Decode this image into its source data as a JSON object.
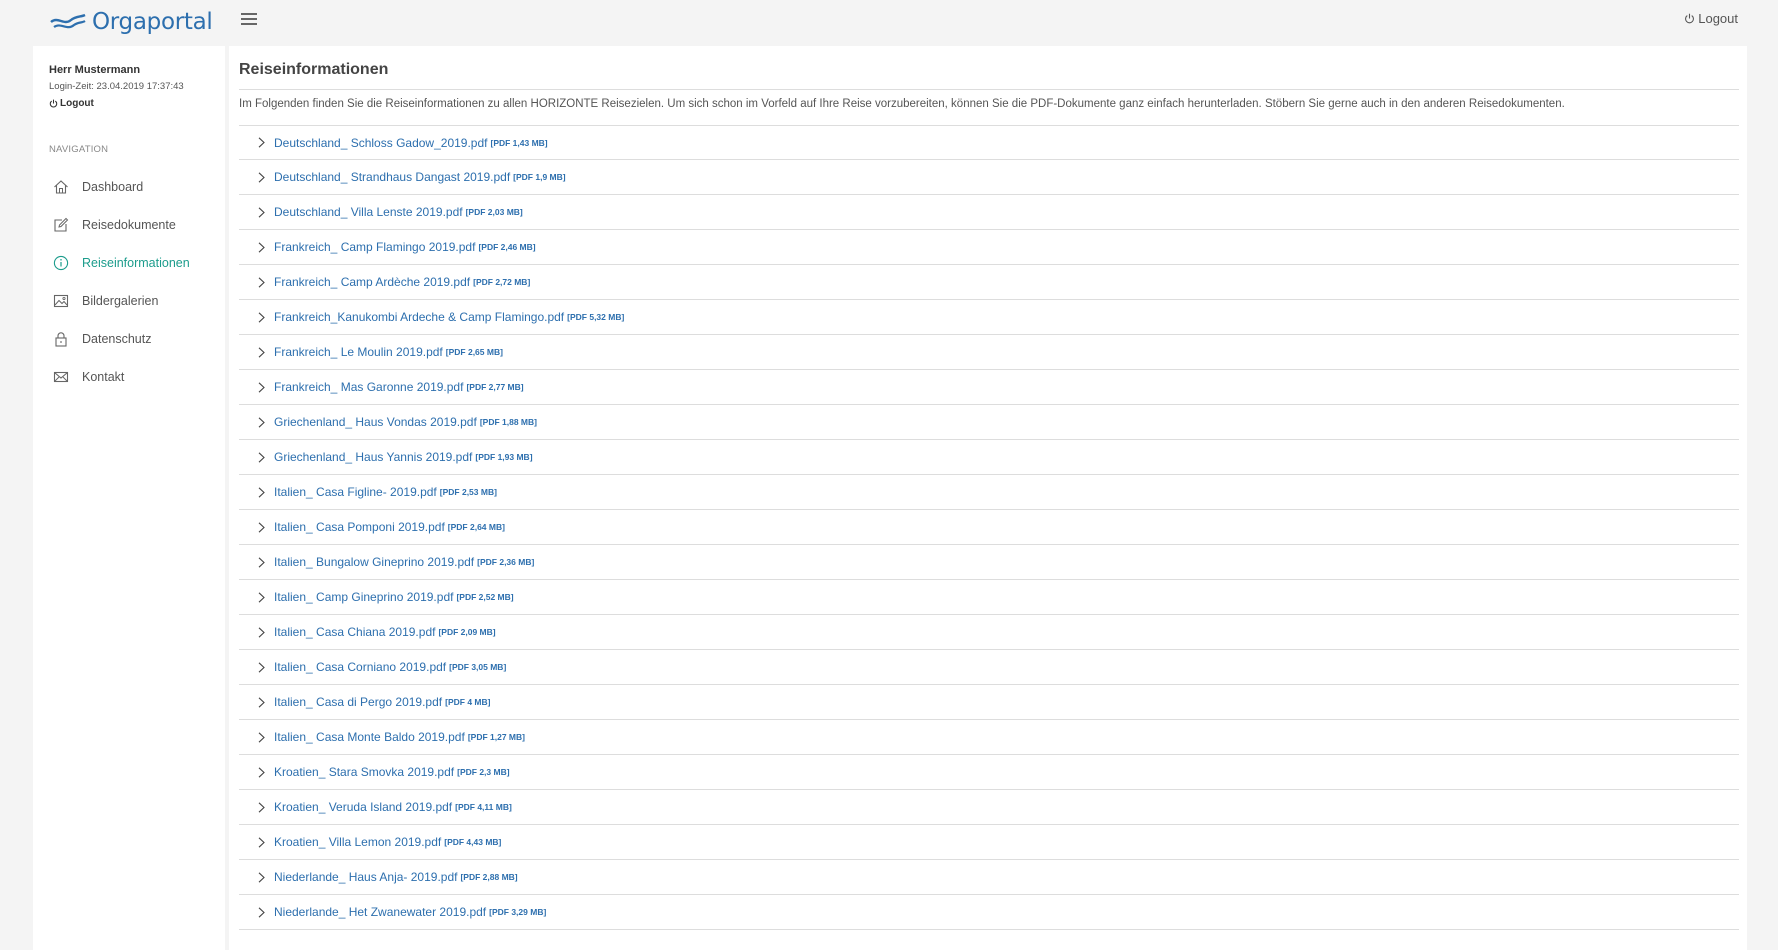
{
  "header": {
    "logo_text": "Orgaportal",
    "logout_label": "Logout"
  },
  "sidebar": {
    "user_name": "Herr Mustermann",
    "login_time": "Login-Zeit: 23.04.2019 17:37:43",
    "logout_label": "Logout",
    "nav_heading": "NAVIGATION",
    "items": [
      {
        "label": "Dashboard",
        "icon": "home-icon",
        "active": false
      },
      {
        "label": "Reisedokumente",
        "icon": "edit-icon",
        "active": false
      },
      {
        "label": "Reiseinformationen",
        "icon": "info-icon",
        "active": true
      },
      {
        "label": "Bildergalerien",
        "icon": "image-icon",
        "active": false
      },
      {
        "label": "Datenschutz",
        "icon": "lock-icon",
        "active": false
      },
      {
        "label": "Kontakt",
        "icon": "envelope-icon",
        "active": false
      }
    ]
  },
  "main": {
    "title": "Reiseinformationen",
    "intro": "Im Folgenden finden Sie die Reiseinformationen zu allen HORIZONTE Reisezielen. Um sich schon im Vorfeld auf Ihre Reise vorzubereiten, können Sie die PDF-Dokumente ganz einfach herunterladen. Stöbern Sie gerne auch in den anderen Reisedokumenten.",
    "files": [
      {
        "name": "Deutschland_ Schloss Gadow_2019.pdf",
        "size": "[PDF 1,43 MB]"
      },
      {
        "name": "Deutschland_ Strandhaus Dangast 2019.pdf",
        "size": "[PDF 1,9 MB]"
      },
      {
        "name": "Deutschland_ Villa Lenste 2019.pdf",
        "size": "[PDF 2,03 MB]"
      },
      {
        "name": "Frankreich_ Camp Flamingo 2019.pdf",
        "size": "[PDF 2,46 MB]"
      },
      {
        "name": "Frankreich_ Camp Ardèche 2019.pdf",
        "size": "[PDF 2,72 MB]"
      },
      {
        "name": "Frankreich_Kanukombi Ardeche & Camp Flamingo.pdf",
        "size": "[PDF 5,32 MB]"
      },
      {
        "name": "Frankreich_ Le Moulin 2019.pdf",
        "size": "[PDF 2,65 MB]"
      },
      {
        "name": "Frankreich_ Mas Garonne 2019.pdf",
        "size": "[PDF 2,77 MB]"
      },
      {
        "name": "Griechenland_ Haus Vondas 2019.pdf",
        "size": "[PDF 1,88 MB]"
      },
      {
        "name": "Griechenland_ Haus Yannis 2019.pdf",
        "size": "[PDF 1,93 MB]"
      },
      {
        "name": "Italien_ Casa Figline- 2019.pdf",
        "size": "[PDF 2,53 MB]"
      },
      {
        "name": "Italien_ Casa Pomponi 2019.pdf",
        "size": "[PDF 2,64 MB]"
      },
      {
        "name": "Italien_ Bungalow Gineprino 2019.pdf",
        "size": "[PDF 2,36 MB]"
      },
      {
        "name": "Italien_ Camp Gineprino 2019.pdf",
        "size": "[PDF 2,52 MB]"
      },
      {
        "name": "Italien_ Casa Chiana 2019.pdf",
        "size": "[PDF 2,09 MB]"
      },
      {
        "name": "Italien_ Casa Corniano 2019.pdf",
        "size": "[PDF 3,05 MB]"
      },
      {
        "name": "Italien_ Casa di Pergo 2019.pdf",
        "size": "[PDF 4 MB]"
      },
      {
        "name": "Italien_ Casa Monte Baldo 2019.pdf",
        "size": "[PDF 1,27 MB]"
      },
      {
        "name": "Kroatien_ Stara Smovka 2019.pdf",
        "size": "[PDF 2,3 MB]"
      },
      {
        "name": "Kroatien_ Veruda Island 2019.pdf",
        "size": "[PDF 4,11 MB]"
      },
      {
        "name": "Kroatien_ Villa Lemon 2019.pdf",
        "size": "[PDF 4,43 MB]"
      },
      {
        "name": "Niederlande_ Haus Anja- 2019.pdf",
        "size": "[PDF 2,88 MB]"
      },
      {
        "name": "Niederlande_ Het Zwanewater 2019.pdf",
        "size": "[PDF 3,29 MB]"
      }
    ]
  },
  "colors": {
    "brand_blue": "#2d6fae",
    "active_teal": "#1c9c8c",
    "background": "#f4f4f4"
  }
}
